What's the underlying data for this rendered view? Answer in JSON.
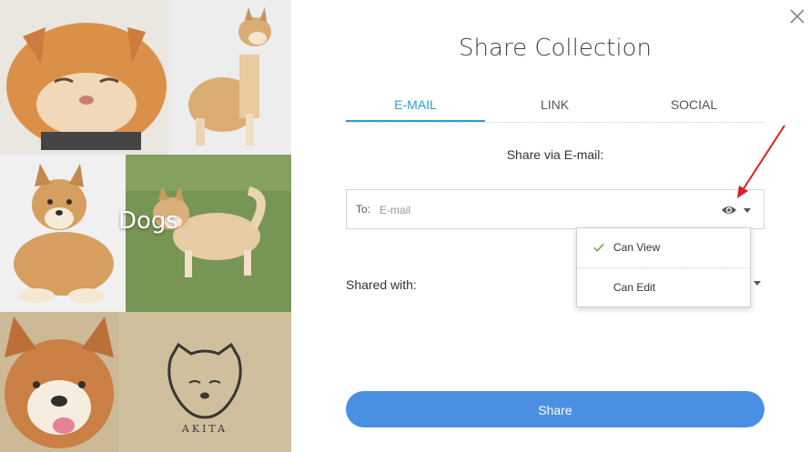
{
  "collection": {
    "name": "Dogs"
  },
  "dialog": {
    "title": "Share Collection",
    "tabs": [
      {
        "label": "E-MAIL",
        "active": true
      },
      {
        "label": "LINK",
        "active": false
      },
      {
        "label": "SOCIAL",
        "active": false
      }
    ],
    "share_via_label": "Share via E-mail:",
    "to_label": "To:",
    "email_placeholder": "E-mail",
    "permission_menu": {
      "items": [
        {
          "label": "Can View",
          "selected": true
        },
        {
          "label": "Can Edit",
          "selected": false
        }
      ]
    },
    "shared_with_label": "Shared with:",
    "share_button": "Share"
  },
  "icons": [
    "close-icon",
    "eye-icon",
    "caret-down-icon",
    "check-icon",
    "red-arrow-annotation"
  ],
  "colors": {
    "accent": "#2a9fd6",
    "button": "#4a90e2",
    "check": "#7cb342",
    "annotation": "#e11d1d"
  }
}
